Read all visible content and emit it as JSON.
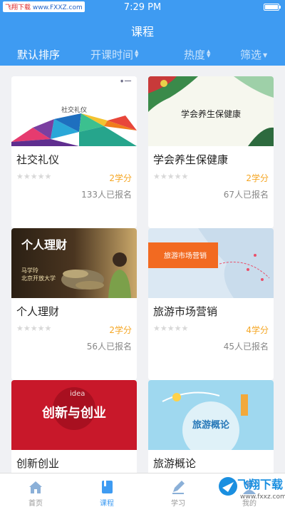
{
  "status_bar": {
    "left_badge_text": "飞翔下载",
    "left_badge_url": "www.FXXZ.com",
    "time": "7:29 PM",
    "battery_level": 1.0
  },
  "header": {
    "title": "课程"
  },
  "sort_bar": {
    "items": [
      {
        "label": "默认排序",
        "active": true
      },
      {
        "label": "开课时间",
        "indicator": "sort-arrows"
      },
      {
        "label": "热度",
        "indicator": "sort-arrows"
      },
      {
        "label": "筛选",
        "indicator": "dropdown-triangle"
      }
    ]
  },
  "courses": [
    {
      "title": "社交礼仪",
      "credits": "2学分",
      "enrolled": "133人已报名",
      "rating": 0,
      "thumb_text": "社交礼仪"
    },
    {
      "title": "学会养生保健康",
      "credits": "2学分",
      "enrolled": "67人已报名",
      "rating": 0,
      "thumb_text": "学会养生保健康"
    },
    {
      "title": "个人理财",
      "credits": "2学分",
      "enrolled": "56人已报名",
      "rating": 0,
      "thumb_text": "个人理财",
      "thumb_sub": [
        "马学玲",
        "北京开放大学"
      ]
    },
    {
      "title": "旅游市场营销",
      "credits": "4学分",
      "enrolled": "45人已报名",
      "rating": 0,
      "thumb_text": "旅游市场营销"
    },
    {
      "title": "创新创业",
      "thumb_text": "创新与创业"
    },
    {
      "title": "旅游概论",
      "thumb_text": "旅游概论"
    }
  ],
  "tab_bar": {
    "tabs": [
      {
        "label": "首页",
        "icon": "home-icon"
      },
      {
        "label": "课程",
        "icon": "book-icon",
        "active": true
      },
      {
        "label": "学习",
        "icon": "pen-icon"
      },
      {
        "label": "我的",
        "icon": "person-icon"
      }
    ]
  },
  "watermark": {
    "text": "飞翔下载",
    "url": "www.fxxz.com"
  },
  "colors": {
    "primary": "#3e9bf2",
    "credit": "#f5a623",
    "star_empty": "#d8d8d8"
  }
}
